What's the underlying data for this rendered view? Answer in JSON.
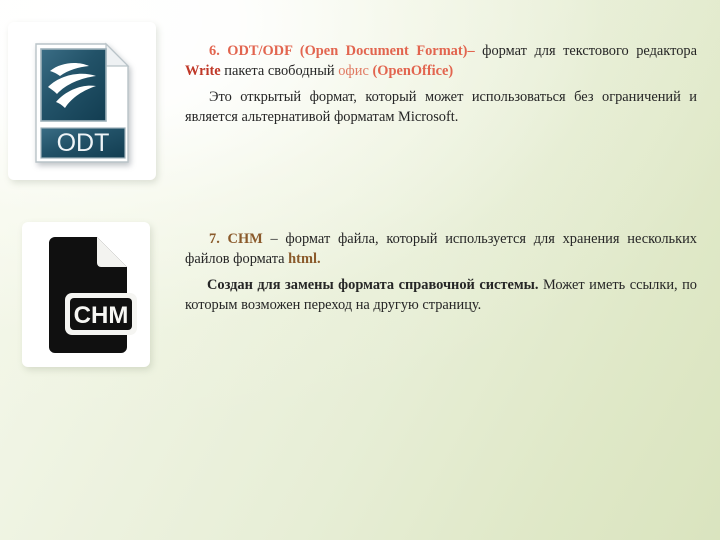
{
  "slide": {
    "background_from": "#f7f9ef",
    "background_to": "#dae4bf"
  },
  "colors": {
    "heading_salmon": "#e2654f",
    "inline_salmon_soft": "#e07a62",
    "inline_crimson": "#c03828",
    "inline_brown": "#8a5a2b",
    "body_text": "#262626",
    "odt_icon_blue": "#1f4d63",
    "chm_icon_black": "#101010"
  },
  "icons": {
    "odt": {
      "name": "odt-file-icon",
      "label": "ODT",
      "glyph": "openoffice-gull",
      "fill": "#1f4d63"
    },
    "chm": {
      "name": "chm-file-icon",
      "label": "CHM",
      "glyph": "document-folded-corner",
      "fill": "#101010"
    }
  },
  "blocks": [
    {
      "id": "odt",
      "heading_number": "6.",
      "heading_title": "ODT/ODF (Open Document Format)",
      "paragraph1": {
        "lead_number": "6.",
        "lead_title": "ODT/ODF (Open Document Format)",
        "dash": "–",
        "text_a": " формат для текстового редактора ",
        "term_write": "Write",
        "text_b": " пакета свободный ",
        "term_office": "офис ",
        "term_openoffice": "(OpenOffice)"
      },
      "paragraph2": "Это открытый формат, который может использоваться без ограничений и является альтернативой форматам Microsoft."
    },
    {
      "id": "chm",
      "paragraph1": {
        "lead_number": "7. ",
        "lead_title": "CHM",
        "text_a": " – формат файла, который используется для хранения нескольких файлов формата ",
        "term_html": "html."
      },
      "paragraph2": {
        "bold_part": "Создан для замены формата справочной системы.",
        "rest": " Может иметь ссылки, по которым возможен переход на другую страницу."
      }
    }
  ]
}
